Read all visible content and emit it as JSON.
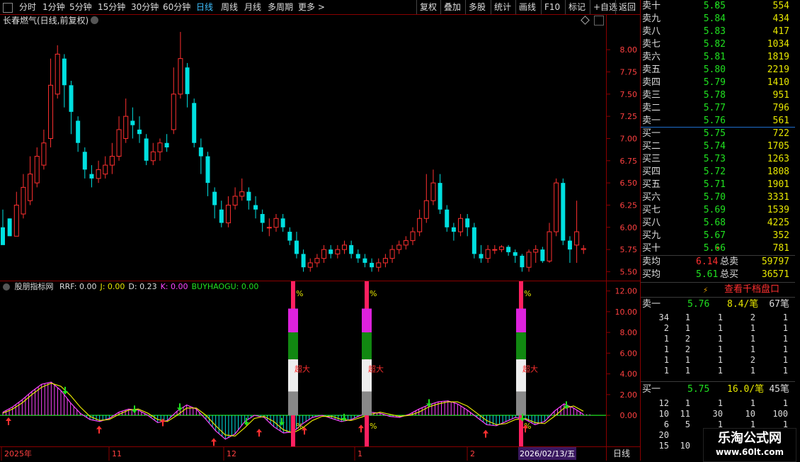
{
  "toolbar": {
    "periods": [
      "分时",
      "1分钟",
      "5分钟",
      "15分钟",
      "30分钟",
      "60分钟",
      "日线",
      "周线",
      "月线",
      "多周期",
      "更多 >"
    ],
    "active_period": "日线",
    "tools": [
      "复权",
      "叠加",
      "多股",
      "统计",
      "画线",
      "F10",
      "标记",
      "+自选",
      "返回"
    ]
  },
  "chart_title": "长春燃气(日线,前复权)",
  "price_axis": {
    "min": 5.5,
    "max": 8.0,
    "ticks": [
      "8.00",
      "7.75",
      "7.50",
      "7.25",
      "7.00",
      "6.75",
      "6.50",
      "6.25",
      "6.00",
      "5.75",
      "5.50"
    ]
  },
  "indicator": {
    "name": "股朋指标网",
    "labels": [
      {
        "text": "RRF: 0.00",
        "color": "#dddddd"
      },
      {
        "text": "J: 0.00",
        "color": "#e6e600"
      },
      {
        "text": "D: 0.23",
        "color": "#dddddd"
      },
      {
        "text": "K: 0.00",
        "color": "#ff44ff"
      },
      {
        "text": "BUYHAOGU: 0.00",
        "color": "#20e020"
      }
    ],
    "axis_ticks": [
      "12.00",
      "10.00",
      "8.00",
      "6.00",
      "4.00",
      "2.00",
      "0.00"
    ],
    "tower_label": "超大",
    "pct": "%"
  },
  "date_axis": {
    "labels": [
      "2025年",
      "11",
      "12",
      "1",
      "2"
    ],
    "current_date": "2026/02/13/五",
    "period_label": "日线"
  },
  "candles": [
    [
      6.0,
      5.8,
      6.2,
      5.9
    ],
    [
      6.1,
      5.9,
      6.1,
      5.95
    ],
    [
      5.9,
      6.25,
      6.4,
      6.15
    ],
    [
      6.15,
      6.45,
      6.6,
      6.1
    ],
    [
      6.3,
      6.6,
      6.8,
      6.25
    ],
    [
      6.5,
      6.8,
      6.9,
      6.45
    ],
    [
      6.7,
      6.95,
      7.1,
      6.65
    ],
    [
      7.0,
      7.6,
      7.9,
      6.9
    ],
    [
      7.5,
      7.95,
      8.05,
      7.45
    ],
    [
      7.9,
      7.6,
      7.95,
      7.35
    ],
    [
      7.6,
      7.3,
      7.65,
      7.05
    ],
    [
      7.2,
      6.95,
      7.25,
      6.85
    ],
    [
      6.85,
      6.65,
      6.9,
      6.55
    ],
    [
      6.6,
      6.55,
      6.7,
      6.45
    ],
    [
      6.55,
      6.65,
      6.75,
      6.5
    ],
    [
      6.6,
      6.7,
      6.8,
      6.55
    ],
    [
      6.7,
      6.8,
      6.95,
      6.6
    ],
    [
      6.8,
      7.1,
      7.25,
      6.75
    ],
    [
      7.0,
      7.25,
      7.45,
      6.95
    ],
    [
      7.2,
      7.15,
      7.35,
      7.0
    ],
    [
      7.1,
      7.05,
      7.25,
      6.95
    ],
    [
      7.0,
      6.75,
      7.05,
      6.7
    ],
    [
      6.75,
      6.85,
      6.95,
      6.7
    ],
    [
      6.85,
      6.95,
      7.0,
      6.75
    ],
    [
      6.95,
      6.9,
      7.05,
      6.85
    ],
    [
      7.1,
      7.5,
      7.8,
      7.05
    ],
    [
      7.5,
      7.9,
      8.2,
      7.45
    ],
    [
      7.8,
      7.5,
      7.85,
      7.35
    ],
    [
      7.4,
      6.95,
      7.45,
      6.9
    ],
    [
      6.9,
      6.8,
      7.0,
      6.6
    ],
    [
      6.8,
      6.5,
      6.85,
      6.35
    ],
    [
      6.4,
      6.25,
      6.45,
      6.1
    ],
    [
      6.2,
      6.05,
      6.3,
      6.0
    ],
    [
      6.05,
      6.25,
      6.35,
      6.0
    ],
    [
      6.25,
      6.35,
      6.45,
      6.2
    ],
    [
      6.35,
      6.4,
      6.55,
      6.3
    ],
    [
      6.4,
      6.3,
      6.45,
      6.2
    ],
    [
      6.25,
      6.2,
      6.35,
      6.1
    ],
    [
      6.15,
      6.05,
      6.2,
      5.95
    ],
    [
      6.0,
      6.0,
      6.1,
      5.9
    ],
    [
      6.0,
      6.1,
      6.15,
      5.95
    ],
    [
      6.1,
      6.0,
      6.15,
      5.95
    ],
    [
      5.95,
      5.85,
      6.0,
      5.8
    ],
    [
      5.85,
      5.7,
      5.95,
      5.65
    ],
    [
      5.7,
      5.55,
      5.75,
      5.5
    ],
    [
      5.55,
      5.6,
      5.65,
      5.5
    ],
    [
      5.6,
      5.65,
      5.7,
      5.55
    ],
    [
      5.65,
      5.75,
      5.8,
      5.6
    ],
    [
      5.75,
      5.7,
      5.8,
      5.65
    ],
    [
      5.7,
      5.75,
      5.8,
      5.65
    ],
    [
      5.75,
      5.8,
      5.85,
      5.7
    ],
    [
      5.8,
      5.7,
      5.85,
      5.65
    ],
    [
      5.7,
      5.65,
      5.75,
      5.6
    ],
    [
      5.65,
      5.6,
      5.7,
      5.55
    ],
    [
      5.6,
      5.55,
      5.65,
      5.5
    ],
    [
      5.55,
      5.6,
      5.65,
      5.5
    ],
    [
      5.6,
      5.65,
      5.7,
      5.55
    ],
    [
      5.65,
      5.75,
      5.8,
      5.6
    ],
    [
      5.75,
      5.8,
      5.85,
      5.7
    ],
    [
      5.8,
      5.85,
      5.9,
      5.75
    ],
    [
      5.85,
      5.95,
      6.0,
      5.8
    ],
    [
      5.95,
      6.1,
      6.2,
      5.9
    ],
    [
      6.1,
      6.3,
      6.6,
      6.05
    ],
    [
      6.3,
      6.5,
      6.65,
      6.25
    ],
    [
      6.5,
      6.2,
      6.6,
      6.15
    ],
    [
      6.2,
      6.0,
      6.25,
      5.95
    ],
    [
      6.0,
      5.95,
      6.05,
      5.85
    ],
    [
      5.95,
      6.1,
      6.15,
      5.9
    ],
    [
      6.1,
      6.0,
      6.15,
      5.9
    ],
    [
      6.0,
      5.7,
      6.05,
      5.65
    ],
    [
      5.7,
      5.65,
      5.8,
      5.6
    ],
    [
      5.65,
      5.75,
      5.8,
      5.6
    ],
    [
      5.75,
      5.75,
      5.8,
      5.7
    ],
    [
      5.75,
      5.78,
      5.8,
      5.72
    ],
    [
      5.78,
      5.72,
      5.8,
      5.68
    ],
    [
      5.72,
      5.68,
      5.75,
      5.6
    ],
    [
      5.68,
      5.55,
      5.7,
      5.5
    ],
    [
      5.55,
      5.72,
      5.75,
      5.5
    ],
    [
      5.72,
      5.75,
      5.8,
      5.6
    ],
    [
      5.75,
      5.62,
      5.78,
      5.6
    ],
    [
      5.62,
      5.95,
      6.05,
      5.6
    ],
    [
      5.95,
      6.5,
      6.55,
      5.9
    ],
    [
      6.5,
      5.85,
      6.55,
      5.8
    ],
    [
      5.85,
      5.75,
      5.9,
      5.6
    ],
    [
      5.8,
      5.95,
      6.3,
      5.6
    ],
    [
      5.75,
      5.76,
      5.8,
      5.7
    ]
  ],
  "ind_line_k": [
    0.3,
    0.8,
    1.5,
    2.3,
    3.0,
    3.2,
    2.4,
    1.2,
    0.2,
    -0.4,
    -0.6,
    -0.3,
    0.3,
    0.6,
    0.5,
    0.0,
    -0.7,
    -0.5,
    0.4,
    1.0,
    0.6,
    -0.4,
    -1.5,
    -2.3,
    -1.8,
    -0.6,
    0.0,
    -0.2,
    -1.1,
    -1.7,
    -1.6,
    -0.8,
    -0.2,
    0.0,
    -0.3,
    -0.6,
    -0.4,
    0.0,
    0.3,
    0.2,
    -0.1,
    -0.2,
    0.1,
    0.6,
    1.0,
    1.3,
    1.4,
    1.1,
    0.5,
    -0.2,
    -0.9,
    -1.0,
    -0.6,
    -0.2,
    -0.4,
    -0.9,
    -0.6,
    0.4,
    1.1,
    0.7,
    0.1
  ],
  "ind_line_j": [
    0.2,
    0.6,
    1.2,
    2.0,
    2.7,
    3.1,
    2.8,
    1.9,
    0.8,
    -0.1,
    -0.5,
    -0.4,
    0.1,
    0.5,
    0.6,
    0.2,
    -0.4,
    -0.6,
    0.0,
    0.7,
    0.7,
    0.0,
    -1.0,
    -1.9,
    -2.0,
    -1.2,
    -0.3,
    -0.1,
    -0.6,
    -1.4,
    -1.7,
    -1.2,
    -0.5,
    -0.1,
    -0.1,
    -0.4,
    -0.5,
    -0.2,
    0.1,
    0.3,
    0.1,
    -0.1,
    0.0,
    0.3,
    0.8,
    1.1,
    1.3,
    1.3,
    0.9,
    0.2,
    -0.5,
    -0.9,
    -0.8,
    -0.4,
    -0.3,
    -0.7,
    -0.8,
    -0.1,
    0.7,
    0.9,
    0.4
  ],
  "sidebar": {
    "asks": [
      {
        "label": "卖十",
        "price": "5.85",
        "vol": "554",
        "mark": "*"
      },
      {
        "label": "卖九",
        "price": "5.84",
        "vol": "434"
      },
      {
        "label": "卖八",
        "price": "5.83",
        "vol": "417"
      },
      {
        "label": "卖七",
        "price": "5.82",
        "vol": "1034"
      },
      {
        "label": "卖六",
        "price": "5.81",
        "vol": "1819"
      },
      {
        "label": "卖五",
        "price": "5.80",
        "vol": "2219"
      },
      {
        "label": "卖四",
        "price": "5.79",
        "vol": "1410"
      },
      {
        "label": "卖三",
        "price": "5.78",
        "vol": "951"
      },
      {
        "label": "卖二",
        "price": "5.77",
        "vol": "796"
      },
      {
        "label": "卖一",
        "price": "5.76",
        "vol": "561"
      }
    ],
    "bids": [
      {
        "label": "买一",
        "price": "5.75",
        "vol": "722"
      },
      {
        "label": "买二",
        "price": "5.74",
        "vol": "1705"
      },
      {
        "label": "买三",
        "price": "5.73",
        "vol": "1263"
      },
      {
        "label": "买四",
        "price": "5.72",
        "vol": "1808"
      },
      {
        "label": "买五",
        "price": "5.71",
        "vol": "1901"
      },
      {
        "label": "买六",
        "price": "5.70",
        "vol": "3331"
      },
      {
        "label": "买七",
        "price": "5.69",
        "vol": "1539"
      },
      {
        "label": "买八",
        "price": "5.68",
        "vol": "4225"
      },
      {
        "label": "买九",
        "price": "5.67",
        "vol": "352"
      },
      {
        "label": "买十",
        "price": "5.66",
        "vol": "781",
        "mark": "▾"
      }
    ],
    "summary": [
      {
        "label": "卖均",
        "price": "6.14",
        "label2": "总卖",
        "vol": "59797",
        "price_color": "#ff3030"
      },
      {
        "label": "买均",
        "price": "5.61",
        "label2": "总买",
        "vol": "36571",
        "price_color": "#20e020"
      }
    ],
    "qiandang_button": "查看千档盘口",
    "sell1_detail": {
      "label": "卖一",
      "price": "5.76",
      "per": "8.4/笔",
      "count": "67笔"
    },
    "sell1_ticks": [
      [
        "34",
        "1",
        "1",
        "2",
        "1"
      ],
      [
        "2",
        "1",
        "1",
        "1",
        "1"
      ],
      [
        "1",
        "2",
        "1",
        "1",
        "1"
      ],
      [
        "1",
        "2",
        "1",
        "1",
        "1"
      ],
      [
        "1",
        "1",
        "1",
        "2",
        "1"
      ],
      [
        "1",
        "1",
        "1",
        "1",
        "1"
      ]
    ],
    "buy1_detail": {
      "label": "买一",
      "price": "5.75",
      "per": "16.0/笔",
      "count": "45笔"
    },
    "buy1_ticks": [
      [
        "12",
        "1",
        "1",
        "1",
        "1"
      ],
      [
        "10",
        "11",
        "30",
        "10",
        "100"
      ],
      [
        "6",
        "5",
        "1",
        "1",
        "1"
      ],
      [
        "20",
        "",
        "",
        "",
        ""
      ],
      [
        "15",
        "10",
        "",
        "",
        ""
      ]
    ]
  },
  "watermark": {
    "name": "乐淘公式网",
    "url": "www.60lt.com"
  },
  "colors": {
    "up": "#ff3030",
    "down": "#00e0e0",
    "frame": "#8a0000",
    "green": "#20e020",
    "yellow": "#e6e600",
    "magenta": "#ff44ff",
    "axis_text": "#ff4040"
  }
}
